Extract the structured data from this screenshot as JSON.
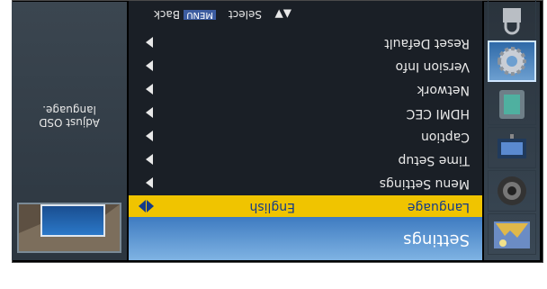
{
  "header": {
    "title": "Settings"
  },
  "icons": [
    "picture-icon",
    "sound-icon",
    "tv-channel-icon",
    "screen-icon",
    "settings-gear-icon",
    "lock-icon"
  ],
  "menu": {
    "items": [
      {
        "label": "Language",
        "value": "English",
        "selected": true
      },
      {
        "label": "Menu Settings"
      },
      {
        "label": "Time Setup"
      },
      {
        "label": "Caption"
      },
      {
        "label": "HDMI CEC"
      },
      {
        "label": "Network"
      },
      {
        "label": "Version Info"
      },
      {
        "label": "Reset Default"
      }
    ]
  },
  "hints": {
    "select_label": "Select",
    "back_key": "MENU",
    "back_label": "Back"
  },
  "description": "Adjust OSD language.",
  "colors": {
    "highlight": "#f0c400",
    "highlight_text": "#143b8a",
    "header": "#4a86c8"
  }
}
